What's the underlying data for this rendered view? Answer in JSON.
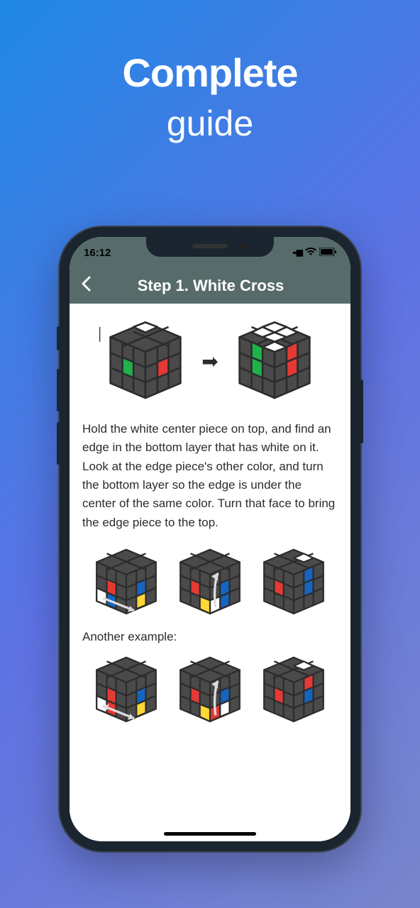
{
  "promo": {
    "title_bold": "Complete",
    "title_light": "guide"
  },
  "status": {
    "time": "16:12"
  },
  "nav": {
    "title": "Step 1. White Cross"
  },
  "content": {
    "paragraph": "Hold the white center piece on top, and find an edge in the bottom layer that has white on it.\nLook at the edge piece's other color, and turn the bottom layer so the edge is under the center of the same color. Turn that face to bring the edge piece to the top.",
    "example_label": "Another example:"
  },
  "colors": {
    "cube_body": "#4a4a4a",
    "cube_edge": "#2c2c2c",
    "white": "#ffffff",
    "green": "#1fb14a",
    "red": "#e53935",
    "blue": "#1565c0",
    "yellow": "#fdd835"
  }
}
